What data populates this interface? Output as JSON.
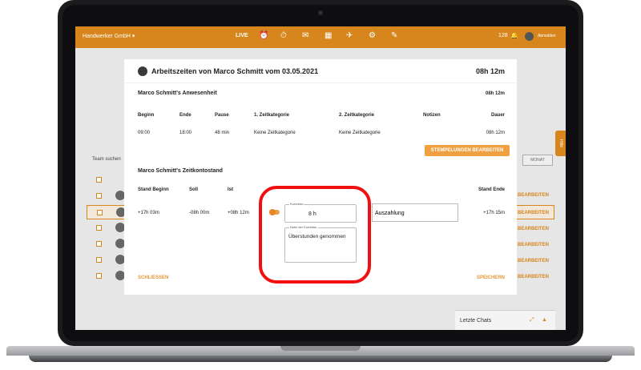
{
  "topbar": {
    "brand": "Handwerker GmbH ▾",
    "live_label": "LIVE",
    "count": "128",
    "logout": "Abmelden"
  },
  "background": {
    "team_search": "Team suchen",
    "monat_button": "MONAT",
    "edit_label": "BEARBEITEN",
    "side_tab": "Hilfe",
    "chats_label": "Letzte Chats"
  },
  "modal": {
    "title": "Arbeitszeiten von Marco Schmitt vom 03.05.2021",
    "title_hours": "08h 12m",
    "presence": {
      "heading": "Marco Schmitt's Anwesenheit",
      "total": "08h 12m",
      "headers": [
        "Beginn",
        "Ende",
        "Pause",
        "1. Zeitkategorie",
        "2. Zeitkategorie",
        "Notizen",
        "Dauer"
      ],
      "row": [
        "09:00",
        "18:00",
        "48 min",
        "Keine Zeitkategorie",
        "Keine Zeitkategorie",
        "",
        "08h 12m"
      ],
      "edit_button": "STEMPELUNGEN BEARBEITEN"
    },
    "account": {
      "heading": "Marco Schmitt's Zeitkontostand",
      "headers": [
        "Stand Beginn",
        "Soll",
        "Ist",
        "Stand Ende"
      ],
      "row": [
        "+17h 03m",
        "-08h 00m",
        "+08h 12m",
        "+17h 15m"
      ],
      "korrektur_label": "Korrektur",
      "korrektur_value": "8 h",
      "notiz_label": "Notiz der Korrektur",
      "notiz_value": "Überstunden genommen",
      "auszahlung": "Auszahlung"
    },
    "close_label": "SCHLIESSEN",
    "save_label": "SPEICHERN"
  },
  "colors": {
    "brand": "#d6861c",
    "accent_button": "#f0a040",
    "highlight": "#f01010"
  }
}
